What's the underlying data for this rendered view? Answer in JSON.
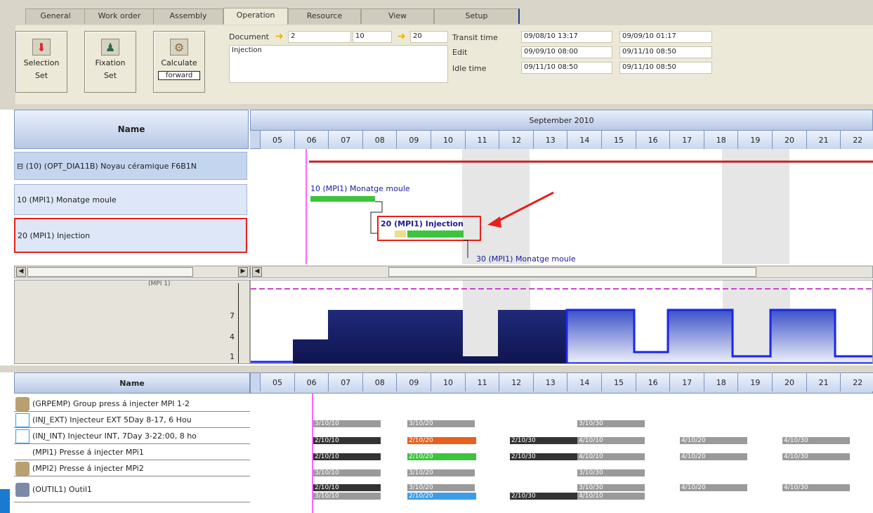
{
  "tabs": [
    "General",
    "Work order",
    "Assembly",
    "Operation",
    "Resource",
    "View",
    "Setup"
  ],
  "toolbar": {
    "selection": {
      "line1": "Selection",
      "line2": "Set"
    },
    "fixation": {
      "line1": "Fixation",
      "line2": "Set"
    },
    "calculate": {
      "line1": "Calculate",
      "line2": "forward"
    }
  },
  "document": {
    "label": "Document",
    "from": "2",
    "mid": "10",
    "to": "20",
    "description": "Injection"
  },
  "times": {
    "transit_label": "Transit time",
    "transit_start": "09/08/10 13:17",
    "transit_end": "09/09/10 01:17",
    "edit_label": "Edit",
    "edit_start": "09/09/10 08:00",
    "edit_end": "09/11/10 08:50",
    "idle_label": "Idle time",
    "idle_start": "09/11/10 08:50",
    "idle_end": "09/11/10 08:50"
  },
  "gantt": {
    "name_header": "Name",
    "month": "September 2010",
    "days": [
      "05",
      "06",
      "07",
      "08",
      "09",
      "10",
      "11",
      "12",
      "13",
      "14",
      "15",
      "16",
      "17",
      "18",
      "19",
      "20",
      "21",
      "22"
    ],
    "operations": [
      "⊟ (10) (OPT_DIA11B) Noyau céramique F6B1N",
      "10 (MPI1) Monatge moule",
      "20 (MPI1) Injection"
    ],
    "bar_labels": {
      "op10": "10 (MPI1) Monatge moule",
      "op20": "20 (MPI1) Injection",
      "op30": "30 (MPI1) Monatge moule",
      "summary": "(10) (OPT_DIA11B) Noyau céramique F6B1N"
    }
  },
  "load_chart": {
    "axis_ticks": [
      "7",
      "4",
      "1"
    ],
    "top_label": "(MPI 1)"
  },
  "resources": {
    "name_header": "Name",
    "rows": [
      "(GRPEMP) Group press á injecter MPI 1-2",
      "(INJ_EXT) Injecteur EXT 5Day 8-17, 6 Hou",
      "(INJ_INT) Injecteur INT, 7Day 3-22:00, 8 ho",
      "(MPI1) Presse á injecter MPi1",
      "(MPI2) Presse á injecter MPi2",
      "(OUTIL1) Outil1"
    ],
    "bar_texts": {
      "a": "3/10/10",
      "b": "3/10/20",
      "c": "3/10/30",
      "d": "2/10/10",
      "e": "2/10/20",
      "f": "2/10/30",
      "g": "4/10/10",
      "h": "4/10/20",
      "i": "4/10/30"
    }
  },
  "colors": {
    "accent_red": "#e8201c",
    "op_green": "#3cc43c",
    "load_dark": "#1f2a7a",
    "load_blue": "#1a26e8",
    "bar_gray": "#9a9a9a",
    "bar_orange": "#e8601c",
    "bar_dark": "#333333",
    "bar_lightblue": "#3c9ce8"
  }
}
